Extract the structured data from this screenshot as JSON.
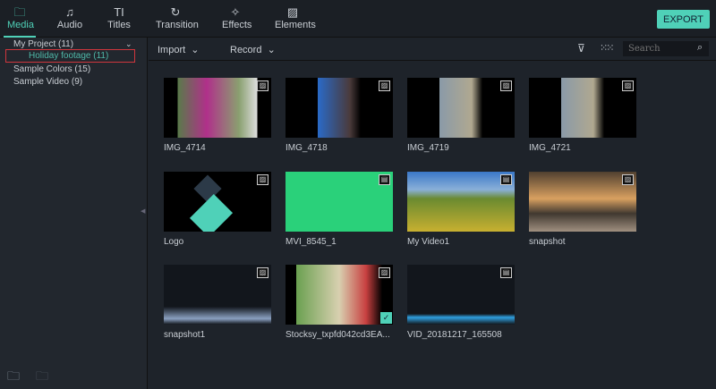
{
  "tabs": [
    {
      "label": "Media",
      "icon": "folder-icon"
    },
    {
      "label": "Audio",
      "icon": "music-note-icon"
    },
    {
      "label": "Titles",
      "icon": "text-icon"
    },
    {
      "label": "Transition",
      "icon": "transition-icon"
    },
    {
      "label": "Effects",
      "icon": "effects-icon"
    },
    {
      "label": "Elements",
      "icon": "image-icon"
    }
  ],
  "export_label": "EXPORT",
  "sidebar": {
    "project": "My Project (11)",
    "selected": "Holiday footage (11)",
    "items": [
      "Sample Colors (15)",
      "Sample Video (9)"
    ]
  },
  "toolbar": {
    "import": "Import",
    "record": "Record",
    "search_placeholder": "Search"
  },
  "accent": "#4fd1b8",
  "media": [
    {
      "name": "IMG_4714",
      "type": "image"
    },
    {
      "name": "IMG_4718",
      "type": "image"
    },
    {
      "name": "IMG_4719",
      "type": "image"
    },
    {
      "name": "IMG_4721",
      "type": "image"
    },
    {
      "name": "Logo",
      "type": "image"
    },
    {
      "name": "MVI_8545_1",
      "type": "video"
    },
    {
      "name": "My Video1",
      "type": "video"
    },
    {
      "name": "snapshot",
      "type": "image"
    },
    {
      "name": "snapshot1",
      "type": "image"
    },
    {
      "name": "Stocksy_txpfd042cd3EA...",
      "type": "image",
      "selected": true
    },
    {
      "name": "VID_20181217_165508",
      "type": "video"
    }
  ]
}
